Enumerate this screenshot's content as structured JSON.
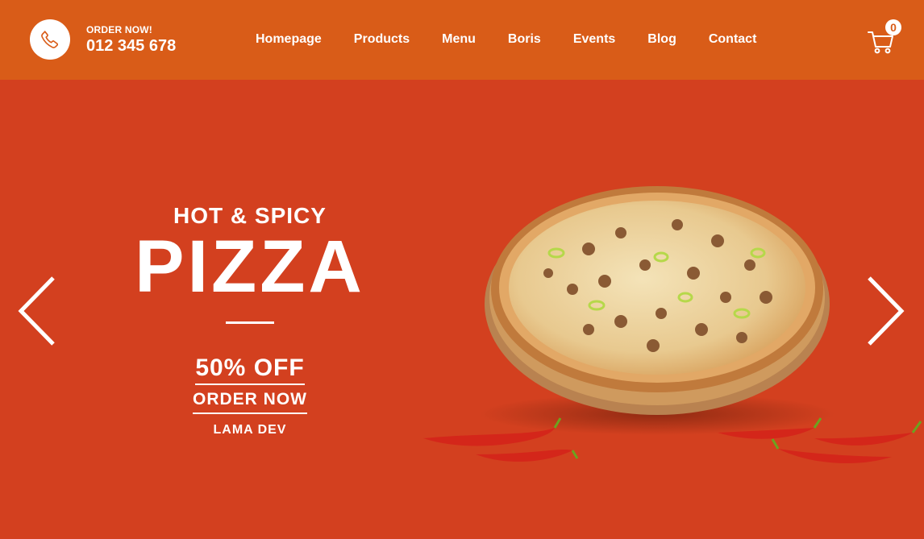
{
  "header": {
    "order_label": "ORDER NOW!",
    "phone_number": "012 345 678",
    "phone_icon": "phone-icon",
    "nav": [
      {
        "label": "Homepage"
      },
      {
        "label": "Products"
      },
      {
        "label": "Menu"
      },
      {
        "label": "Boris"
      },
      {
        "label": "Events"
      },
      {
        "label": "Blog"
      },
      {
        "label": "Contact"
      }
    ],
    "cart_icon": "cart-icon",
    "cart_count": "0"
  },
  "hero": {
    "subtitle": "HOT & SPICY",
    "title": "PIZZA",
    "discount": "50% OFF",
    "cta": "ORDER NOW",
    "brand": "LAMA DEV",
    "image": "pizza-image",
    "prev_icon": "chevron-left-icon",
    "next_icon": "chevron-right-icon"
  },
  "colors": {
    "navbar": "#d95c18",
    "hero_bg": "#d3401f",
    "text": "#ffffff"
  }
}
